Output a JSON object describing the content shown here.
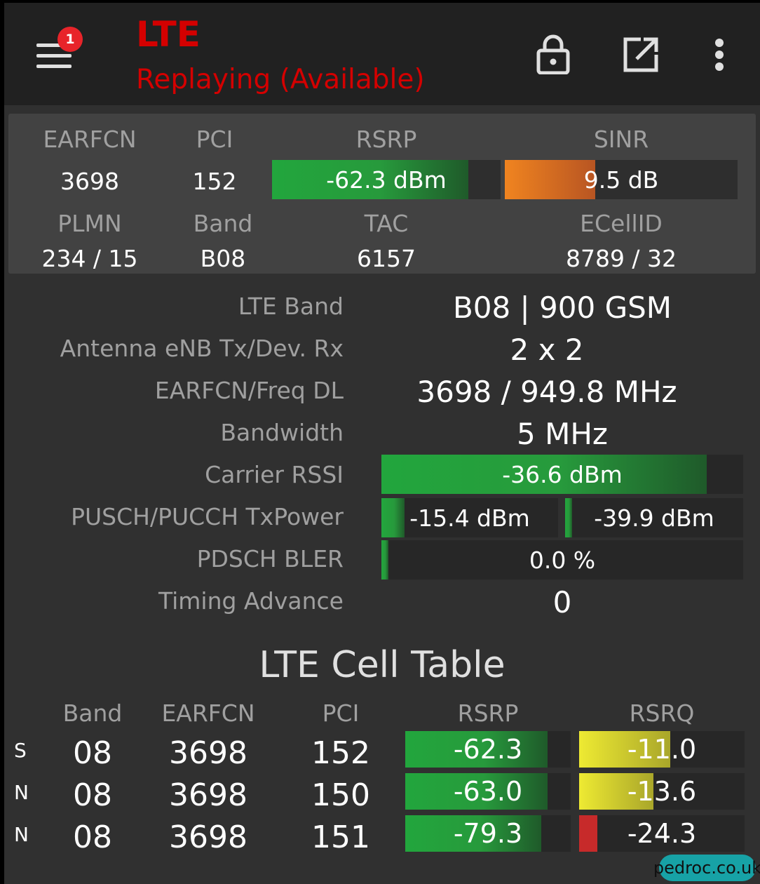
{
  "header": {
    "title": "LTE",
    "status": "Replaying (Available)",
    "notification_count": "1",
    "icons": [
      "menu-icon",
      "lock-icon",
      "open-external-icon",
      "more-vert-icon"
    ]
  },
  "summary": {
    "labels": {
      "earfcn": "EARFCN",
      "pci": "PCI",
      "rsrp": "RSRP",
      "sinr": "SINR",
      "plmn": "PLMN",
      "band": "Band",
      "tac": "TAC",
      "ecellid": "ECellID"
    },
    "values": {
      "earfcn": "3698",
      "pci": "152",
      "rsrp": "-62.3 dBm",
      "sinr": "9.5 dB",
      "plmn": "234 / 15",
      "band": "B08",
      "tac": "6157",
      "ecellid": "8789 / 32"
    },
    "levels": {
      "rsrp": 0.86,
      "sinr": 0.39
    }
  },
  "details": {
    "lte_band": {
      "label": "LTE Band",
      "value": "B08 | 900 GSM"
    },
    "antenna": {
      "label": "Antenna eNB Tx/Dev. Rx",
      "value": "2 x 2"
    },
    "earfcn_freq": {
      "label": "EARFCN/Freq DL",
      "value": "3698 / 949.8 MHz"
    },
    "bandwidth": {
      "label": "Bandwidth",
      "value": "5 MHz"
    },
    "carrier_rssi": {
      "label": "Carrier RSSI",
      "value": "-36.6 dBm",
      "level": 0.9
    },
    "tx_power": {
      "label": "PUSCH/PUCCH TxPower",
      "pusch": "-15.4 dBm",
      "pucch": "-39.9 dBm",
      "pusch_level": 0.13,
      "pucch_level": 0.04
    },
    "bler": {
      "label": "PDSCH BLER",
      "value": "0.0 %",
      "level": 0.02
    },
    "timing_advance": {
      "label": "Timing Advance",
      "value": "0"
    }
  },
  "cell_table": {
    "title": "LTE Cell Table",
    "headers": [
      "Band",
      "EARFCN",
      "PCI",
      "RSRP",
      "RSRQ"
    ],
    "rows": [
      {
        "type": "S",
        "band": "08",
        "earfcn": "3698",
        "pci": "152",
        "rsrp": "-62.3",
        "rsrq": "-11.0",
        "rsrp_level": 0.86,
        "rsrq_level": 0.55,
        "rsrq_color": "yellow"
      },
      {
        "type": "N",
        "band": "08",
        "earfcn": "3698",
        "pci": "150",
        "rsrp": "-63.0",
        "rsrq": "-13.6",
        "rsrp_level": 0.86,
        "rsrq_level": 0.45,
        "rsrq_color": "yellow"
      },
      {
        "type": "N",
        "band": "08",
        "earfcn": "3698",
        "pci": "151",
        "rsrp": "-79.3",
        "rsrq": "-24.3",
        "rsrp_level": 0.82,
        "rsrq_level": 0.11,
        "rsrq_color": "red"
      }
    ]
  },
  "watermark": "pedroc.co.uk"
}
